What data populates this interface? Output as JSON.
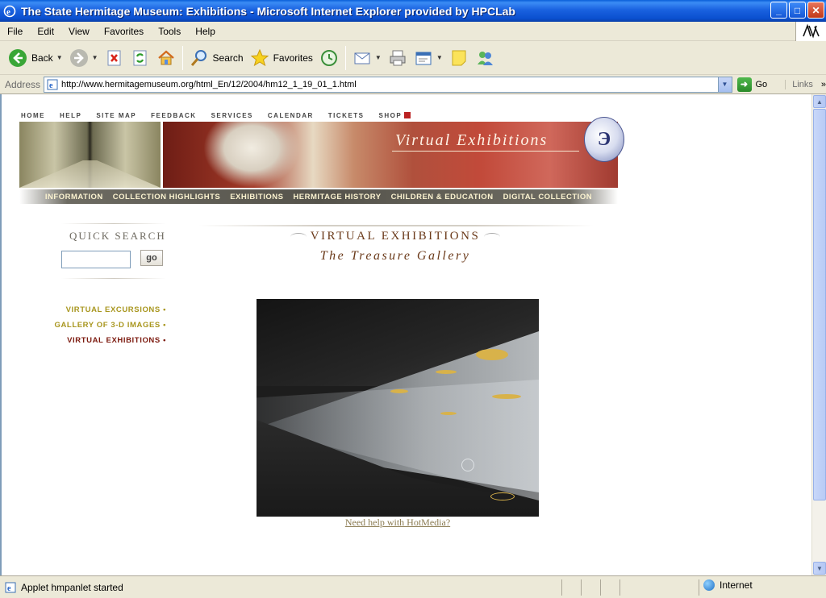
{
  "window": {
    "title": "The State Hermitage Museum: Exhibitions - Microsoft Internet Explorer provided by HPCLab",
    "buttons": {
      "minimize": "_",
      "maximize": "□",
      "close": "✕"
    }
  },
  "menu": [
    "File",
    "Edit",
    "View",
    "Favorites",
    "Tools",
    "Help"
  ],
  "toolbar": {
    "back_label": "Back",
    "search_label": "Search",
    "favorites_label": "Favorites"
  },
  "address": {
    "label": "Address",
    "url": "http://www.hermitagemuseum.org/html_En/12/2004/hm12_1_19_01_1.html",
    "go_label": "Go",
    "links_label": "Links"
  },
  "page": {
    "top_nav": [
      "HOME",
      "HELP",
      "SITE MAP",
      "FEEDBACK",
      "SERVICES",
      "CALENDAR",
      "TICKETS",
      "SHOP"
    ],
    "banner_title": "Virtual Exhibitions",
    "main_nav": [
      "INFORMATION",
      "COLLECTION HIGHLIGHTS",
      "EXHIBITIONS",
      "HERMITAGE HISTORY",
      "CHILDREN & EDUCATION",
      "DIGITAL COLLECTION"
    ],
    "quick_search": {
      "title": "QUICK SEARCH",
      "value": "",
      "go_label": "go"
    },
    "side_links": [
      "VIRTUAL EXCURSIONS •",
      "GALLERY OF 3-D IMAGES •",
      "VIRTUAL EXHIBITIONS •"
    ],
    "section_title": "VIRTUAL EXHIBITIONS",
    "section_subtitle": "The Treasure Gallery",
    "help_link": "Need help with HotMedia?"
  },
  "status": {
    "text": "Applet hmpanlet started",
    "zone": "Internet"
  }
}
